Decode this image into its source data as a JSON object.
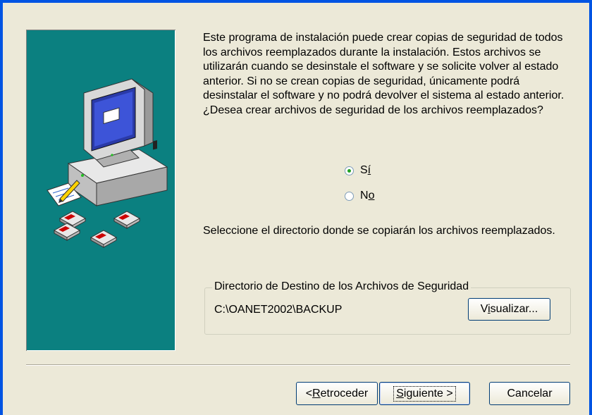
{
  "description": "Este programa de instalación puede crear copias de seguridad de todos los archivos reemplazados durante la instalación. Estos archivos se utilizarán cuando se desinstale el software y se solicite volver al estado anterior. Si no se crean copias de seguridad, únicamente podrá desinstalar el software y no podrá devolver el sistema al estado anterior. ¿Desea crear archivos de seguridad de los archivos reemplazados?",
  "backup_choice": {
    "options": [
      {
        "label_pre": "S",
        "label_key": "í",
        "label_post": "",
        "checked": true
      },
      {
        "label_pre": "N",
        "label_key": "o",
        "label_post": "",
        "checked": false
      }
    ]
  },
  "select_directory_text": "Seleccione el directorio donde se copiarán los archivos reemplazados.",
  "destination": {
    "group_label": "Directorio de Destino de los Archivos de Seguridad",
    "path": "C:\\OANET2002\\BACKUP",
    "browse_pre": "V",
    "browse_key": "i",
    "browse_post": "sualizar..."
  },
  "buttons": {
    "back_pre": "<",
    "back_key": "R",
    "back_post": "etroceder",
    "next_pre": "",
    "next_key": "S",
    "next_post": "iguiente >",
    "cancel": "Cancelar"
  },
  "colors": {
    "window_frame": "#0054e3",
    "side_panel": "#0b8080",
    "dialog_background": "#ece9d8"
  },
  "side_panel_icons": [
    "computer-icon",
    "notepad-icon",
    "floppy-disk-icon"
  ]
}
